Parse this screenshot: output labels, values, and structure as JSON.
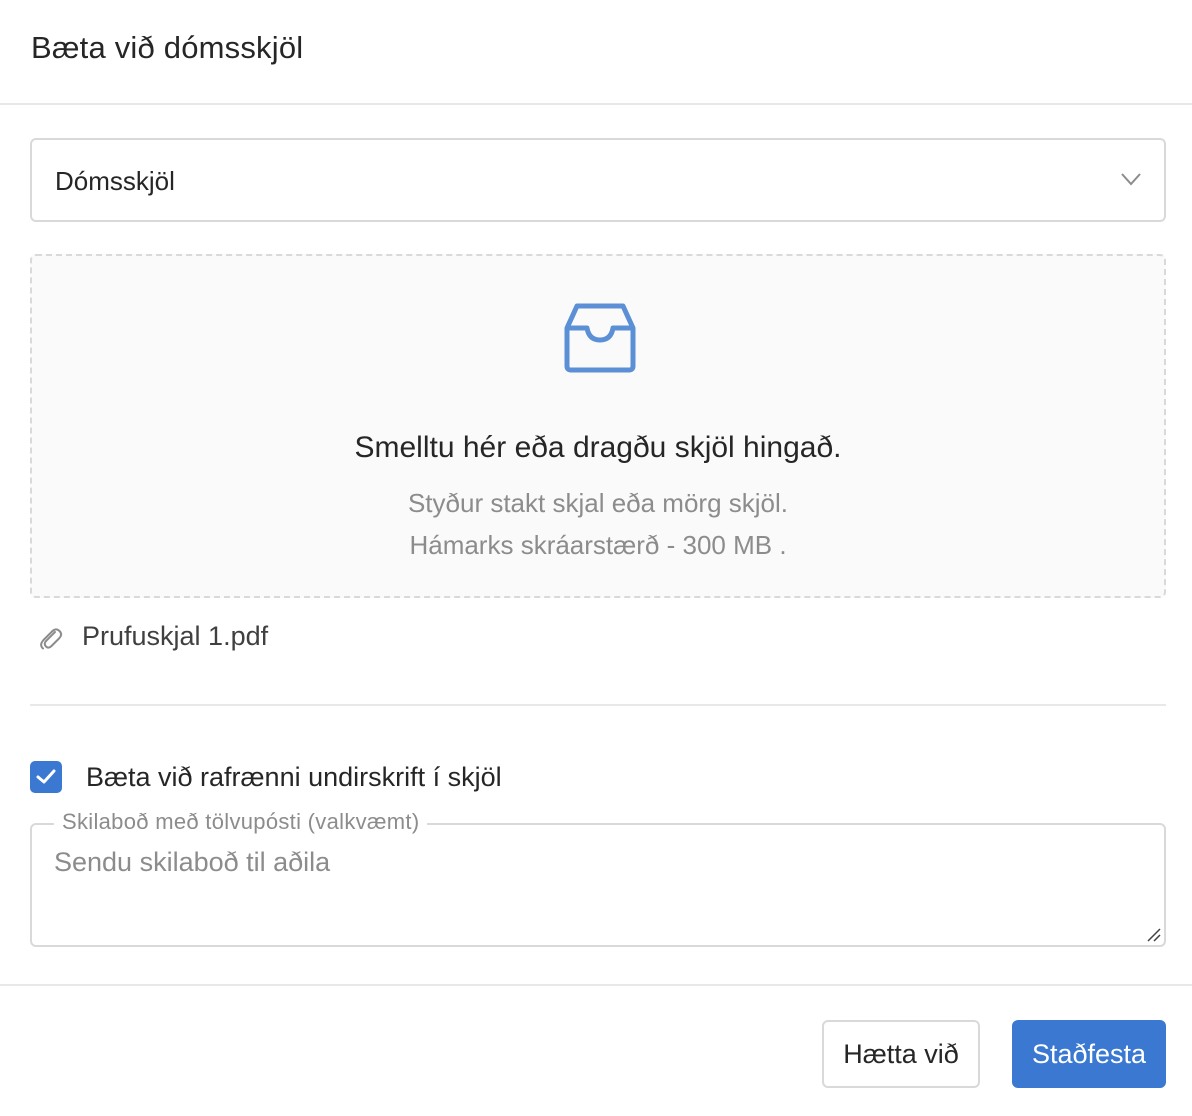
{
  "header": {
    "title": "Bæta við dómsskjöl"
  },
  "document_type_select": {
    "value": "Dómsskjöl",
    "icon": "chevron-down-icon"
  },
  "dropzone": {
    "icon": "inbox-icon",
    "title": "Smelltu hér eða dragðu skjöl hingað.",
    "hint_line1": "Styður stakt skjal eða mörg skjöl.",
    "hint_line2": "Hámarks skráarstærð - 300 MB ."
  },
  "files": [
    {
      "name": "Prufuskjal 1.pdf",
      "icon": "paperclip-icon"
    }
  ],
  "signature_option": {
    "label": "Bæta við rafrænni undirskrift í skjöl",
    "checked": true
  },
  "message_field": {
    "label": "Skilaboð með tölvupósti (valkvæmt)",
    "placeholder": "Sendu skilaboð til aðila",
    "value": ""
  },
  "footer": {
    "cancel_label": "Hætta við",
    "confirm_label": "Staðfesta"
  },
  "colors": {
    "primary": "#3a78d1",
    "border": "#d9d9d9",
    "text": "#262626",
    "muted": "#8c8c8c",
    "dropzone_bg": "#fafafa",
    "icon_blue": "#5b90d6"
  }
}
